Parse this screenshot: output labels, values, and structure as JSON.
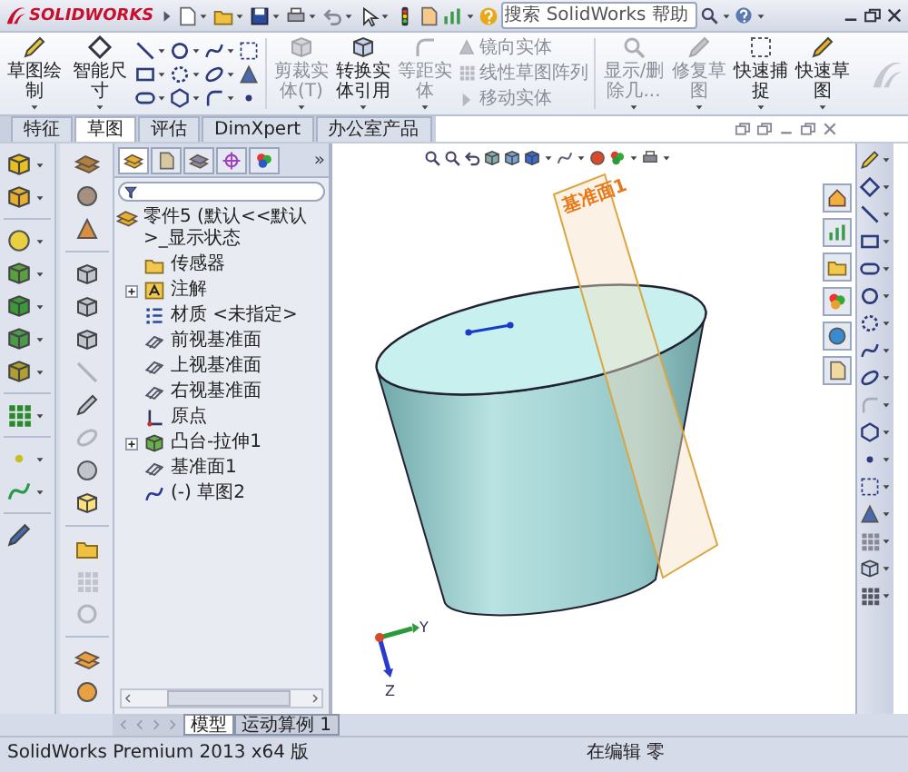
{
  "window": {
    "logo": "SOLIDWORKS"
  },
  "search": {
    "placeholder": "搜索 SolidWorks 帮助"
  },
  "ribbon": {
    "main_buttons": [
      {
        "label": "草图绘制",
        "disabled": false
      },
      {
        "label": "智能尺寸",
        "disabled": false
      }
    ],
    "entity_buttons": [
      {
        "label": "剪裁实体(T)",
        "disabled": true
      },
      {
        "label": "转换实体引用",
        "disabled": false
      },
      {
        "label": "等距实体",
        "disabled": true
      }
    ],
    "entity_list": [
      {
        "label": "镜向实体",
        "disabled": true
      },
      {
        "label": "线性草图阵列",
        "disabled": true
      },
      {
        "label": "移动实体",
        "disabled": true
      }
    ],
    "repair_buttons": [
      {
        "label": "显示/删除几...",
        "disabled": true
      },
      {
        "label": "修复草图",
        "disabled": true
      },
      {
        "label": "快速捕捉",
        "disabled": false
      },
      {
        "label": "快速草图",
        "disabled": false
      }
    ]
  },
  "tabs": [
    {
      "label": "特征",
      "selected": false
    },
    {
      "label": "草图",
      "selected": true
    },
    {
      "label": "评估",
      "selected": false
    },
    {
      "label": "DimXpert",
      "selected": false
    },
    {
      "label": "办公室产品",
      "selected": false
    }
  ],
  "feature_tree": {
    "more": "»",
    "root": {
      "label": "零件5 (默认<<默认>_显示状态",
      "kind": "part",
      "children": [
        {
          "label": "传感器",
          "kind": "sensors"
        },
        {
          "label": "注解",
          "kind": "annotations",
          "expanded": false
        },
        {
          "label": "材质 <未指定>",
          "kind": "material"
        },
        {
          "label": "前视基准面",
          "kind": "plane"
        },
        {
          "label": "上视基准面",
          "kind": "plane"
        },
        {
          "label": "右视基准面",
          "kind": "plane"
        },
        {
          "label": "原点",
          "kind": "origin"
        },
        {
          "label": "凸台-拉伸1",
          "kind": "feature",
          "expanded": false
        },
        {
          "label": "基准面1",
          "kind": "plane"
        },
        {
          "label": "(-) 草图2",
          "kind": "sketch"
        }
      ]
    }
  },
  "graphics": {
    "plane_label": "基准面1",
    "triad": {
      "axes": [
        "Y",
        "Z"
      ]
    }
  },
  "bottom_tabs": [
    {
      "label": "模型",
      "selected": true
    },
    {
      "label": "运动算例 1",
      "selected": false
    }
  ],
  "status_bar": {
    "product": "SolidWorks Premium 2013 x64 版",
    "mode": "在编辑 零"
  }
}
